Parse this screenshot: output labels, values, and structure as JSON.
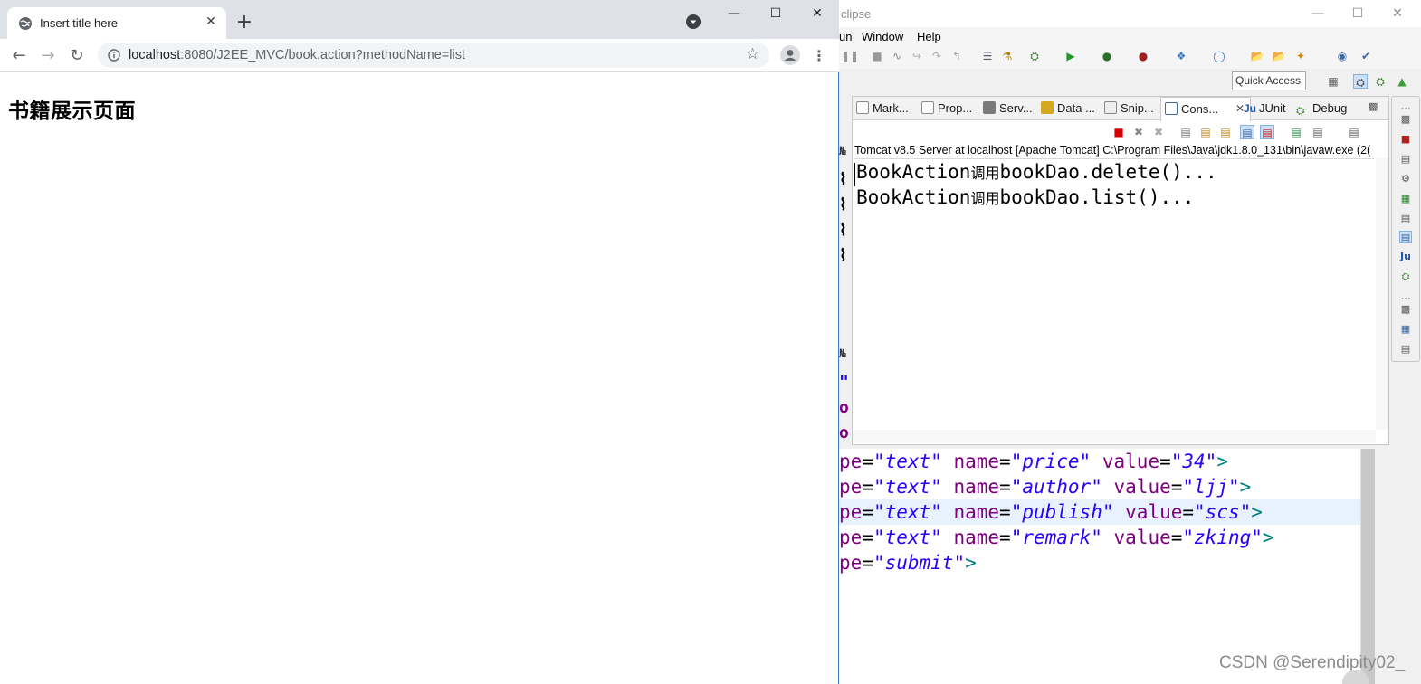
{
  "eclipse": {
    "title_fragment": "clipse",
    "menu": [
      "un",
      "Window",
      "Help"
    ],
    "quick_access_label": "Quick Access",
    "view_tabs": [
      {
        "label": "Mark...",
        "icon": "markers-icon"
      },
      {
        "label": "Prop...",
        "icon": "properties-icon"
      },
      {
        "label": "Serv...",
        "icon": "servers-icon"
      },
      {
        "label": "Data ...",
        "icon": "data-source-icon"
      },
      {
        "label": "Snip...",
        "icon": "snippets-icon"
      },
      {
        "label": "Cons...",
        "icon": "console-icon"
      },
      {
        "label": "JUnit",
        "icon": "junit-icon"
      },
      {
        "label": "Debug",
        "icon": "debug-icon"
      }
    ],
    "console_header": "Tomcat v8.5 Server at localhost [Apache Tomcat] C:\\Program Files\\Java\\jdk1.8.0_131\\bin\\javaw.exe (2(",
    "console_lines": [
      {
        "pre": "BookAction",
        "cjk": "调用",
        "post": "bookDao.delete()..."
      },
      {
        "pre": "BookAction",
        "cjk": "调用",
        "post": "bookDao.list()..."
      }
    ],
    "editor_lines": [
      {
        "attr": "pe",
        "type": "\"text\"",
        "name": "\"price\"",
        "value": "\"34\"",
        "close": ">"
      },
      {
        "attr": "pe",
        "type": "\"text\"",
        "name": "\"author\"",
        "value": "\"ljj\"",
        "close": ">"
      },
      {
        "attr": "pe",
        "type": "\"text\"",
        "name": "\"publish\"",
        "value": "\"scs\"",
        "close": ">"
      },
      {
        "attr": "pe",
        "type": "\"text\"",
        "name": "\"remark\"",
        "value": "\"zking\"",
        "close": ">"
      },
      {
        "attr": "pe",
        "type": "\"submit\"",
        "close": ">"
      }
    ],
    "editor_keyword_name": "name",
    "editor_keyword_value": "value",
    "watermark": "CSDN @Serendipity02_"
  },
  "chrome": {
    "tab_title": "Insert title here",
    "url_host": "localhost",
    "url_rest": ":8080/J2EE_MVC/book.action?methodName=list",
    "page_heading": "书籍展示页面"
  },
  "colors": {
    "tag_keyword": "#7f007f",
    "string_value": "#2a00ff",
    "bracket": "#008080",
    "chrome_tabstrip": "#dee1e6",
    "console_terminate": "#d40000"
  }
}
